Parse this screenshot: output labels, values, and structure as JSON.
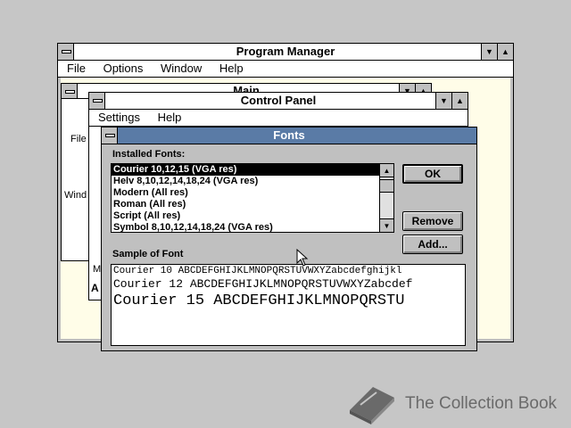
{
  "program_manager": {
    "title": "Program Manager",
    "menu": [
      "File",
      "Options",
      "Window",
      "Help"
    ]
  },
  "main_group": {
    "title": "Main",
    "icon_labels": [
      "File",
      "Wind",
      "M",
      "A"
    ]
  },
  "control_panel": {
    "title": "Control Panel",
    "menu": [
      "Settings",
      "Help"
    ]
  },
  "fonts_dialog": {
    "title": "Fonts",
    "installed_label": "Installed Fonts:",
    "fonts": [
      "Courier 10,12,15 (VGA res)",
      "Helv 8,10,12,14,18,24 (VGA res)",
      "Modern (All res)",
      "Roman (All res)",
      "Script (All res)",
      "Symbol 8,10,12,14,18,24 (VGA res)"
    ],
    "selected_index": 0,
    "buttons": {
      "ok": "OK",
      "remove": "Remove",
      "add": "Add..."
    },
    "sample_label": "Sample of Font",
    "samples": [
      "Courier 10  ABCDEFGHIJKLMNOPQRSTUVWXYZabcdefghijkl",
      "Courier 12  ABCDEFGHIJKLMNOPQRSTUVWXYZabcdef",
      "Courier 15  ABCDEFGHIJKLMNOPQRSTU"
    ]
  },
  "watermark": {
    "text": "The Collection Book"
  },
  "colors": {
    "desktop": "#c6c6c6",
    "active_title": "#5a7ba6",
    "window_frame": "#c0c0c0"
  }
}
